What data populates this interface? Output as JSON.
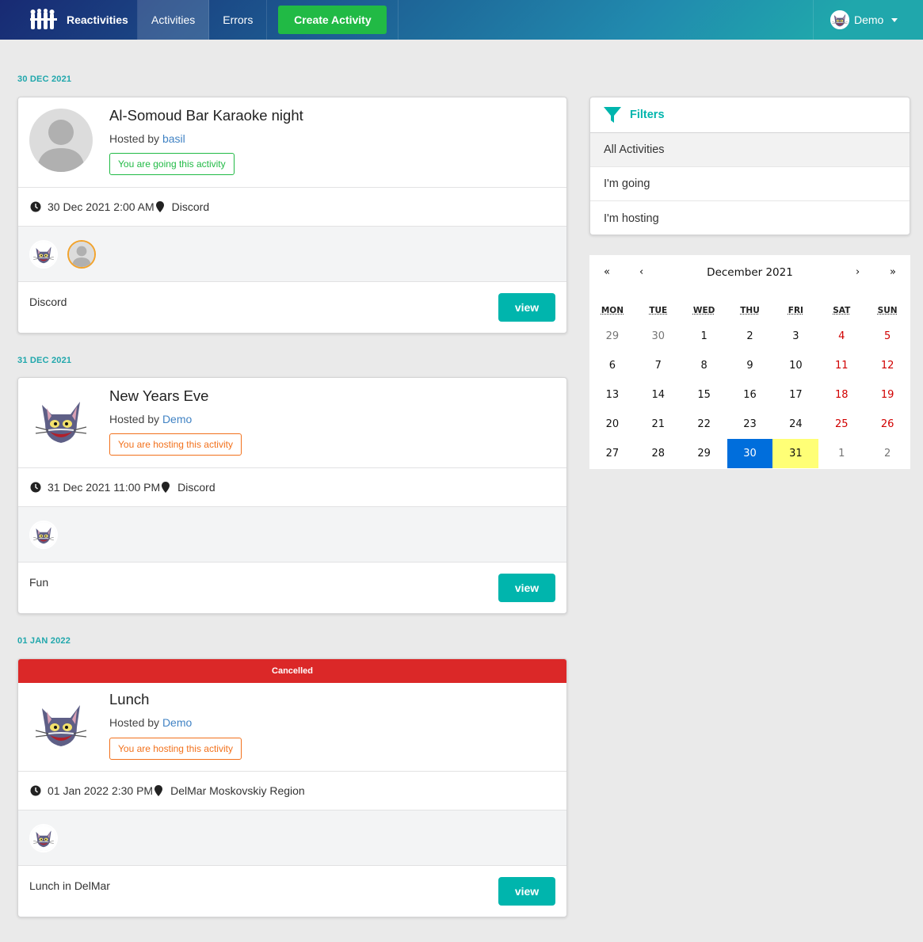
{
  "nav": {
    "brand": "Reactivities",
    "activities": "Activities",
    "errors": "Errors",
    "create": "Create Activity",
    "user": "Demo"
  },
  "groups": [
    {
      "date": "30 DEC 2021",
      "activity": {
        "title": "Al-Somoud Bar Karaoke night",
        "hosted_prefix": "Hosted by",
        "host": "basil",
        "badge": "You are going this activity",
        "datetime": "30 Dec 2021 2:00 AM",
        "venue": "Discord",
        "description": "Discord",
        "view": "view"
      }
    },
    {
      "date": "31 DEC 2021",
      "activity": {
        "title": "New Years Eve",
        "hosted_prefix": "Hosted by",
        "host": "Demo",
        "badge": "You are hosting this activity",
        "datetime": "31 Dec 2021 11:00 PM",
        "venue": "Discord",
        "description": "Fun",
        "view": "view"
      }
    },
    {
      "date": "01 JAN 2022",
      "activity": {
        "cancelled": "Cancelled",
        "title": "Lunch",
        "hosted_prefix": "Hosted by",
        "host": "Demo",
        "badge": "You are hosting this activity",
        "datetime": "01 Jan 2022 2:30 PM",
        "venue": "DelMar Moskovskiy Region",
        "description": "Lunch in DelMar",
        "view": "view"
      }
    }
  ],
  "filters": {
    "title": "Filters",
    "items": [
      "All Activities",
      "I'm going",
      "I'm hosting"
    ],
    "selected": "All Activities"
  },
  "calendar": {
    "prev2": "«",
    "prev": "‹",
    "month": "December 2021",
    "next": "›",
    "next2": "»",
    "weekdays": [
      "MON",
      "TUE",
      "WED",
      "THU",
      "FRI",
      "SAT",
      "SUN"
    ],
    "days": [
      "29",
      "30",
      "1",
      "2",
      "3",
      "4",
      "5",
      "6",
      "7",
      "8",
      "9",
      "10",
      "11",
      "12",
      "13",
      "14",
      "15",
      "16",
      "17",
      "18",
      "19",
      "20",
      "21",
      "22",
      "23",
      "24",
      "25",
      "26",
      "27",
      "28",
      "29",
      "30",
      "31",
      "1",
      "2"
    ],
    "selected_day": "30",
    "today": "31"
  },
  "colors": {
    "teal": "#00b5ad",
    "green": "#21ba45",
    "orange": "#f2711c",
    "red": "#db2828",
    "link": "#4183c4"
  }
}
